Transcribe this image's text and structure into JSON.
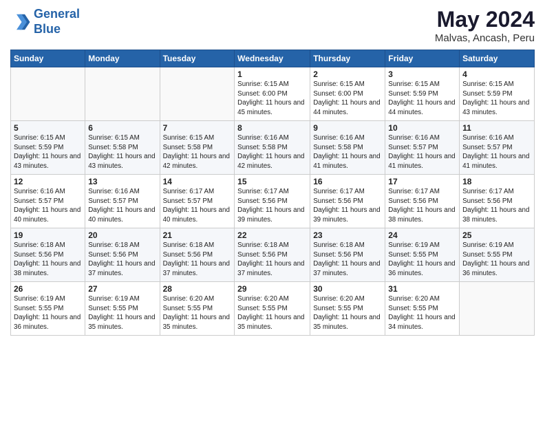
{
  "header": {
    "logo_line1": "General",
    "logo_line2": "Blue",
    "month_title": "May 2024",
    "location": "Malvas, Ancash, Peru"
  },
  "days_of_week": [
    "Sunday",
    "Monday",
    "Tuesday",
    "Wednesday",
    "Thursday",
    "Friday",
    "Saturday"
  ],
  "weeks": [
    [
      {
        "day": "",
        "info": ""
      },
      {
        "day": "",
        "info": ""
      },
      {
        "day": "",
        "info": ""
      },
      {
        "day": "1",
        "info": "Sunrise: 6:15 AM\nSunset: 6:00 PM\nDaylight: 11 hours\nand 45 minutes."
      },
      {
        "day": "2",
        "info": "Sunrise: 6:15 AM\nSunset: 6:00 PM\nDaylight: 11 hours\nand 44 minutes."
      },
      {
        "day": "3",
        "info": "Sunrise: 6:15 AM\nSunset: 5:59 PM\nDaylight: 11 hours\nand 44 minutes."
      },
      {
        "day": "4",
        "info": "Sunrise: 6:15 AM\nSunset: 5:59 PM\nDaylight: 11 hours\nand 43 minutes."
      }
    ],
    [
      {
        "day": "5",
        "info": "Sunrise: 6:15 AM\nSunset: 5:59 PM\nDaylight: 11 hours\nand 43 minutes."
      },
      {
        "day": "6",
        "info": "Sunrise: 6:15 AM\nSunset: 5:58 PM\nDaylight: 11 hours\nand 43 minutes."
      },
      {
        "day": "7",
        "info": "Sunrise: 6:15 AM\nSunset: 5:58 PM\nDaylight: 11 hours\nand 42 minutes."
      },
      {
        "day": "8",
        "info": "Sunrise: 6:16 AM\nSunset: 5:58 PM\nDaylight: 11 hours\nand 42 minutes."
      },
      {
        "day": "9",
        "info": "Sunrise: 6:16 AM\nSunset: 5:58 PM\nDaylight: 11 hours\nand 41 minutes."
      },
      {
        "day": "10",
        "info": "Sunrise: 6:16 AM\nSunset: 5:57 PM\nDaylight: 11 hours\nand 41 minutes."
      },
      {
        "day": "11",
        "info": "Sunrise: 6:16 AM\nSunset: 5:57 PM\nDaylight: 11 hours\nand 41 minutes."
      }
    ],
    [
      {
        "day": "12",
        "info": "Sunrise: 6:16 AM\nSunset: 5:57 PM\nDaylight: 11 hours\nand 40 minutes."
      },
      {
        "day": "13",
        "info": "Sunrise: 6:16 AM\nSunset: 5:57 PM\nDaylight: 11 hours\nand 40 minutes."
      },
      {
        "day": "14",
        "info": "Sunrise: 6:17 AM\nSunset: 5:57 PM\nDaylight: 11 hours\nand 40 minutes."
      },
      {
        "day": "15",
        "info": "Sunrise: 6:17 AM\nSunset: 5:56 PM\nDaylight: 11 hours\nand 39 minutes."
      },
      {
        "day": "16",
        "info": "Sunrise: 6:17 AM\nSunset: 5:56 PM\nDaylight: 11 hours\nand 39 minutes."
      },
      {
        "day": "17",
        "info": "Sunrise: 6:17 AM\nSunset: 5:56 PM\nDaylight: 11 hours\nand 38 minutes."
      },
      {
        "day": "18",
        "info": "Sunrise: 6:17 AM\nSunset: 5:56 PM\nDaylight: 11 hours\nand 38 minutes."
      }
    ],
    [
      {
        "day": "19",
        "info": "Sunrise: 6:18 AM\nSunset: 5:56 PM\nDaylight: 11 hours\nand 38 minutes."
      },
      {
        "day": "20",
        "info": "Sunrise: 6:18 AM\nSunset: 5:56 PM\nDaylight: 11 hours\nand 37 minutes."
      },
      {
        "day": "21",
        "info": "Sunrise: 6:18 AM\nSunset: 5:56 PM\nDaylight: 11 hours\nand 37 minutes."
      },
      {
        "day": "22",
        "info": "Sunrise: 6:18 AM\nSunset: 5:56 PM\nDaylight: 11 hours\nand 37 minutes."
      },
      {
        "day": "23",
        "info": "Sunrise: 6:18 AM\nSunset: 5:56 PM\nDaylight: 11 hours\nand 37 minutes."
      },
      {
        "day": "24",
        "info": "Sunrise: 6:19 AM\nSunset: 5:55 PM\nDaylight: 11 hours\nand 36 minutes."
      },
      {
        "day": "25",
        "info": "Sunrise: 6:19 AM\nSunset: 5:55 PM\nDaylight: 11 hours\nand 36 minutes."
      }
    ],
    [
      {
        "day": "26",
        "info": "Sunrise: 6:19 AM\nSunset: 5:55 PM\nDaylight: 11 hours\nand 36 minutes."
      },
      {
        "day": "27",
        "info": "Sunrise: 6:19 AM\nSunset: 5:55 PM\nDaylight: 11 hours\nand 35 minutes."
      },
      {
        "day": "28",
        "info": "Sunrise: 6:20 AM\nSunset: 5:55 PM\nDaylight: 11 hours\nand 35 minutes."
      },
      {
        "day": "29",
        "info": "Sunrise: 6:20 AM\nSunset: 5:55 PM\nDaylight: 11 hours\nand 35 minutes."
      },
      {
        "day": "30",
        "info": "Sunrise: 6:20 AM\nSunset: 5:55 PM\nDaylight: 11 hours\nand 35 minutes."
      },
      {
        "day": "31",
        "info": "Sunrise: 6:20 AM\nSunset: 5:55 PM\nDaylight: 11 hours\nand 34 minutes."
      },
      {
        "day": "",
        "info": ""
      }
    ]
  ]
}
